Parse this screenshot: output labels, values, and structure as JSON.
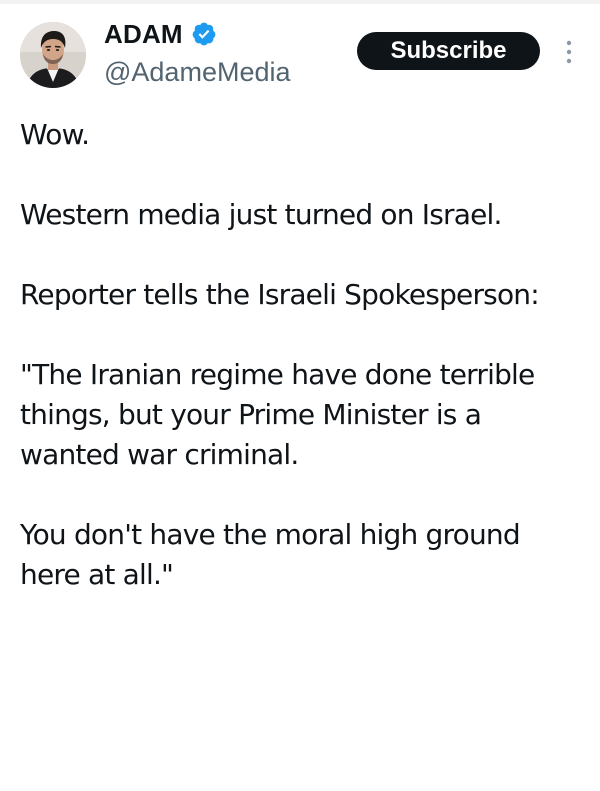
{
  "author": {
    "display_name": "ADAM",
    "handle": "@AdameMedia",
    "verified_icon": "verified-badge-icon",
    "verified_color": "#1d9bf0"
  },
  "actions": {
    "subscribe_label": "Subscribe",
    "more_icon": "more-vertical-icon"
  },
  "tweet": {
    "paragraphs": [
      "Wow.",
      "Western media just turned on Israel.",
      "Reporter tells the Israeli Spokesperson:",
      "\"The Iranian regime have done terrible things, but your Prime Minister is a wanted war criminal.",
      "You don't have the moral high ground here at all.\""
    ]
  }
}
